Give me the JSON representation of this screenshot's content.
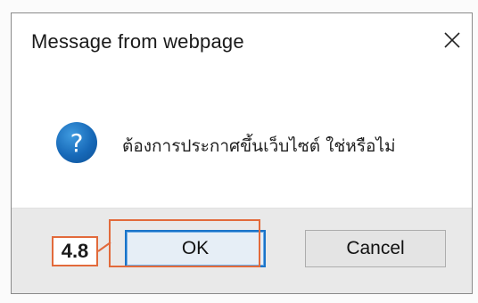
{
  "dialog": {
    "title": "Message from webpage",
    "close_icon": "close-icon",
    "message": "ต้องการประกาศขึ้นเว็บไซต์ ใช่หรือไม่",
    "icon": "question-icon",
    "icon_glyph": "?",
    "ok_label": "OK",
    "cancel_label": "Cancel"
  },
  "annotation": {
    "callout_label": "4.8",
    "color": "#e26a3b"
  }
}
